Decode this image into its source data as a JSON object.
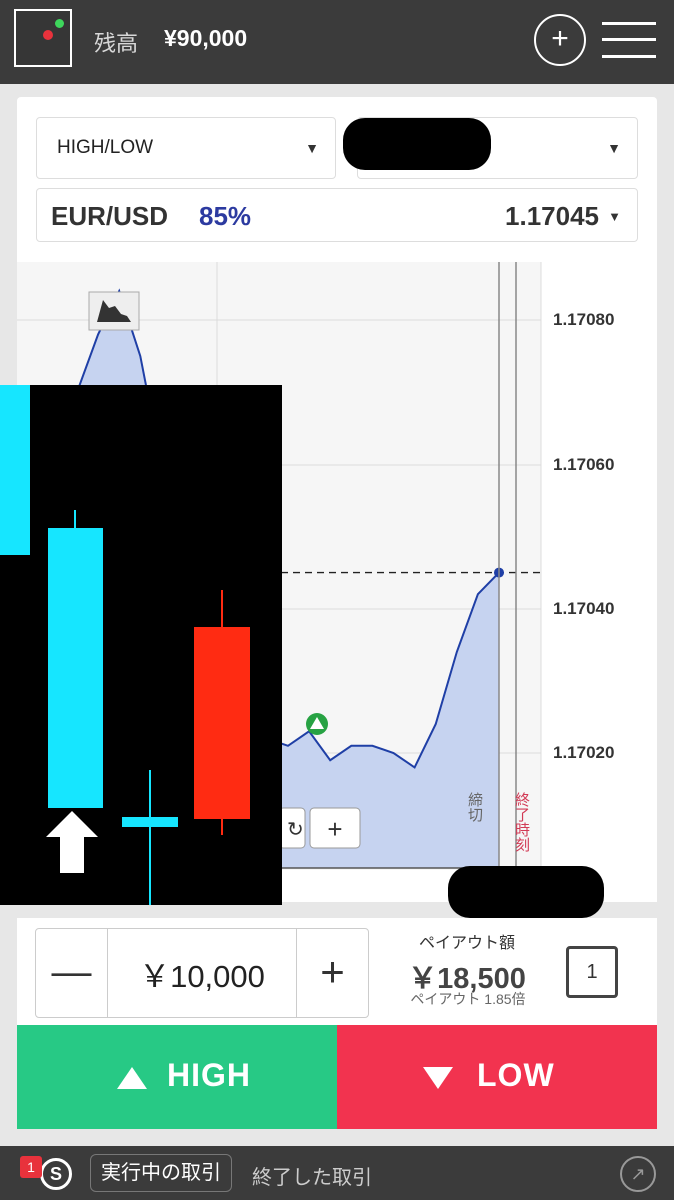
{
  "header": {
    "balance_label": "残高",
    "balance_value": "¥90,000",
    "plus_icon": "+"
  },
  "selectors": {
    "trade_type": "HIGH/LOW"
  },
  "asset": {
    "pair": "EUR/USD",
    "payout_pct": "85%",
    "rate": "1.17045"
  },
  "chart": {
    "price_ticks": [
      "1.17080",
      "1.17060",
      "1.17040",
      "1.17020"
    ],
    "deadline_label": "締切",
    "end_time_label": "終了時刻",
    "zoom_in_icon": "+"
  },
  "chart_data": {
    "type": "line",
    "x": [
      0,
      5,
      10,
      15,
      20,
      25,
      30,
      35,
      40,
      45,
      50,
      55,
      60,
      65,
      70,
      75,
      80,
      85,
      90,
      95,
      100
    ],
    "y": [
      1.1707,
      1.17078,
      1.17084,
      1.17075,
      1.1706,
      1.17042,
      1.17035,
      1.1703,
      1.17026,
      1.17022,
      1.17021,
      1.17023,
      1.17019,
      1.17021,
      1.17021,
      1.1702,
      1.17018,
      1.17024,
      1.17034,
      1.17042,
      1.17045
    ],
    "current_rate": 1.17045,
    "ylim": [
      1.1701,
      1.1709
    ]
  },
  "order": {
    "minus": "—",
    "amount": "￥10,000",
    "plus": "+",
    "payout_label": "ペイアウト額",
    "payout_value": "￥18,500",
    "payout_rate": "ペイアウト 1.85倍",
    "one_click": "1"
  },
  "actions": {
    "high_label": "HIGH",
    "low_label": "LOW"
  },
  "footer": {
    "badge": "1",
    "s_icon": "S",
    "tab_active": "実行中の取引",
    "tab_inactive": "終了した取引"
  },
  "colors": {
    "high": "#27c985",
    "low": "#f2334f",
    "accent": "#2c3aa0",
    "line": "#1f3fa6",
    "fill": "#c6d3f0"
  }
}
